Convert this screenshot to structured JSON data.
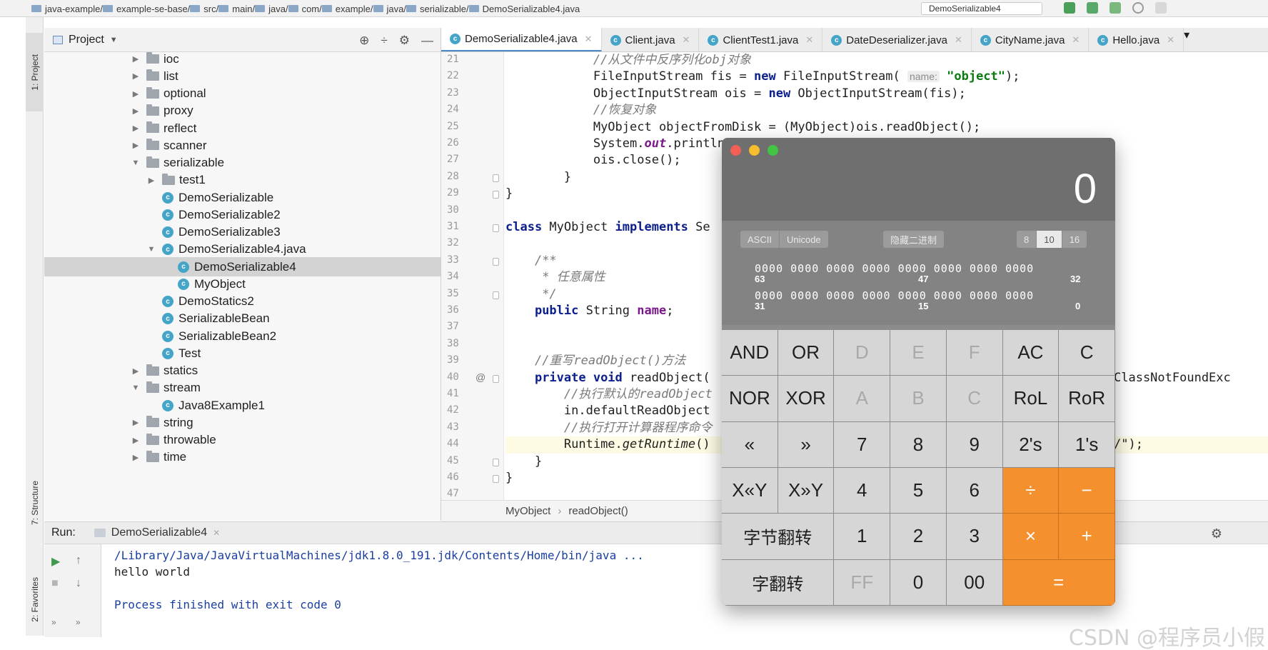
{
  "breadcrumbs": [
    "java-example",
    "example-se-base",
    "src",
    "main",
    "java",
    "com",
    "example",
    "java",
    "serializable",
    "DemoSerializable4.java"
  ],
  "run_config": "DemoSerializable4",
  "left_stripe": {
    "project": "1: Project",
    "structure": "7: Structure",
    "favorites": "2: Favorites"
  },
  "project_panel": {
    "title": "Project",
    "tree": [
      {
        "label": "ioc",
        "kind": "folder",
        "depth": 0,
        "expanded": false
      },
      {
        "label": "list",
        "kind": "folder",
        "depth": 0,
        "expanded": false
      },
      {
        "label": "optional",
        "kind": "folder",
        "depth": 0,
        "expanded": false
      },
      {
        "label": "proxy",
        "kind": "folder",
        "depth": 0,
        "expanded": false
      },
      {
        "label": "reflect",
        "kind": "folder",
        "depth": 0,
        "expanded": false
      },
      {
        "label": "scanner",
        "kind": "folder",
        "depth": 0,
        "expanded": false
      },
      {
        "label": "serializable",
        "kind": "folder",
        "depth": 0,
        "expanded": true
      },
      {
        "label": "test1",
        "kind": "folder",
        "depth": 1,
        "expanded": false
      },
      {
        "label": "DemoSerializable",
        "kind": "class",
        "depth": 1
      },
      {
        "label": "DemoSerializable2",
        "kind": "class",
        "depth": 1
      },
      {
        "label": "DemoSerializable3",
        "kind": "class",
        "depth": 1
      },
      {
        "label": "DemoSerializable4.java",
        "kind": "file",
        "depth": 1,
        "expanded": true
      },
      {
        "label": "DemoSerializable4",
        "kind": "class",
        "depth": 2,
        "selected": true
      },
      {
        "label": "MyObject",
        "kind": "class",
        "depth": 2
      },
      {
        "label": "DemoStatics2",
        "kind": "class",
        "depth": 1
      },
      {
        "label": "SerializableBean",
        "kind": "class",
        "depth": 1
      },
      {
        "label": "SerializableBean2",
        "kind": "class",
        "depth": 1
      },
      {
        "label": "Test",
        "kind": "class",
        "depth": 1
      },
      {
        "label": "statics",
        "kind": "folder",
        "depth": 0,
        "expanded": false
      },
      {
        "label": "stream",
        "kind": "folder",
        "depth": 0,
        "expanded": true
      },
      {
        "label": "Java8Example1",
        "kind": "class",
        "depth": 1
      },
      {
        "label": "string",
        "kind": "folder",
        "depth": 0,
        "expanded": false
      },
      {
        "label": "throwable",
        "kind": "folder",
        "depth": 0,
        "expanded": false
      },
      {
        "label": "time",
        "kind": "folder",
        "depth": 0,
        "expanded": false
      }
    ]
  },
  "tabs": [
    {
      "label": "DemoSerializable4.java",
      "active": true
    },
    {
      "label": "Client.java",
      "active": false
    },
    {
      "label": "ClientTest1.java",
      "active": false
    },
    {
      "label": "DateDeserializer.java",
      "active": false
    },
    {
      "label": "CityName.java",
      "active": false
    },
    {
      "label": "Hello.java",
      "active": false
    }
  ],
  "editor": {
    "line_numbers": [
      "21",
      "22",
      "23",
      "24",
      "25",
      "26",
      "27",
      "28",
      "29",
      "30",
      "31",
      "32",
      "33",
      "34",
      "35",
      "36",
      "37",
      "38",
      "39",
      "40",
      "41",
      "42",
      "43",
      "44",
      "45",
      "46",
      "47"
    ],
    "lines": [
      {
        "indent": "            ",
        "parts": [
          [
            "cm",
            "//从文件中反序列化obj对象"
          ]
        ]
      },
      {
        "indent": "            ",
        "parts": [
          [
            "t",
            "FileInputStream fis = "
          ],
          [
            "kw",
            "new"
          ],
          [
            "t",
            " FileInputStream( "
          ],
          [
            "hint",
            "name:"
          ],
          [
            "t",
            " "
          ],
          [
            "str",
            "\"object\""
          ],
          [
            "t",
            ");"
          ]
        ]
      },
      {
        "indent": "            ",
        "parts": [
          [
            "t",
            "ObjectInputStream ois = "
          ],
          [
            "kw",
            "new"
          ],
          [
            "t",
            " ObjectInputStream(fis);"
          ]
        ]
      },
      {
        "indent": "            ",
        "parts": [
          [
            "cm",
            "//恢复对象"
          ]
        ]
      },
      {
        "indent": "            ",
        "parts": [
          [
            "t",
            "MyObject objectFromDisk = (MyObject)ois.readObject();"
          ]
        ]
      },
      {
        "indent": "            ",
        "parts": [
          [
            "t",
            "System."
          ],
          [
            "fld",
            "out"
          ],
          [
            "t",
            ".println(o"
          ]
        ]
      },
      {
        "indent": "            ",
        "parts": [
          [
            "t",
            "ois.close();"
          ]
        ]
      },
      {
        "indent": "        ",
        "parts": [
          [
            "t",
            "}"
          ]
        ]
      },
      {
        "indent": "",
        "parts": [
          [
            "t",
            "}"
          ]
        ]
      },
      {
        "indent": "",
        "parts": []
      },
      {
        "indent": "",
        "parts": [
          [
            "kw",
            "class"
          ],
          [
            "t",
            " MyObject "
          ],
          [
            "kw",
            "implements"
          ],
          [
            "t",
            " Se"
          ]
        ]
      },
      {
        "indent": "",
        "parts": []
      },
      {
        "indent": "    ",
        "parts": [
          [
            "cm",
            "/**"
          ]
        ]
      },
      {
        "indent": "    ",
        "parts": [
          [
            "cm",
            " * 任意属性"
          ]
        ]
      },
      {
        "indent": "    ",
        "parts": [
          [
            "cm",
            " */"
          ]
        ]
      },
      {
        "indent": "    ",
        "parts": [
          [
            "kw",
            "public"
          ],
          [
            "t",
            " String "
          ],
          [
            "fld2",
            "name"
          ],
          [
            "t",
            ";"
          ]
        ]
      },
      {
        "indent": "",
        "parts": []
      },
      {
        "indent": "",
        "parts": []
      },
      {
        "indent": "    ",
        "parts": [
          [
            "cm",
            "//重写readObject()方法"
          ]
        ]
      },
      {
        "indent": "    ",
        "parts": [
          [
            "kw",
            "private void"
          ],
          [
            "t",
            " readObject("
          ]
        ]
      },
      {
        "indent": "        ",
        "parts": [
          [
            "cm",
            "//执行默认的readObject"
          ]
        ]
      },
      {
        "indent": "        ",
        "parts": [
          [
            "t",
            "in.defaultReadObject"
          ]
        ]
      },
      {
        "indent": "        ",
        "parts": [
          [
            "cm",
            "//执行打开计算器程序命令"
          ]
        ]
      },
      {
        "indent": "        ",
        "parts": [
          [
            "t",
            "Runtime."
          ],
          [
            "mth",
            "getRuntime"
          ],
          [
            "t",
            "()"
          ]
        ]
      },
      {
        "indent": "    ",
        "parts": [
          [
            "t",
            "}"
          ]
        ]
      },
      {
        "indent": "",
        "parts": [
          [
            "t",
            "}"
          ]
        ]
      },
      {
        "indent": "",
        "parts": []
      }
    ],
    "right_fragments": [
      {
        "line": 19,
        "text": "ClassNotFoundExc"
      },
      {
        "line": 23,
        "text": "/\");"
      }
    ],
    "breadcrumb": [
      "MyObject",
      "readObject()"
    ]
  },
  "run_panel": {
    "label": "Run:",
    "tab": "DemoSerializable4",
    "console": [
      {
        "text": "/Library/Java/JavaVirtualMachines/jdk1.8.0_191.jdk/Contents/Home/bin/java ...",
        "style": "blue"
      },
      {
        "text": "hello world",
        "style": "plain"
      },
      {
        "text": "",
        "style": "plain"
      },
      {
        "text": "Process finished with exit code 0",
        "style": "blue"
      }
    ]
  },
  "calculator": {
    "display": "0",
    "traffic_lights": [
      "#f25f57",
      "#f6bd2f",
      "#42c444"
    ],
    "modes": {
      "encoding": [
        "ASCII",
        "Unicode"
      ],
      "binary_toggle": "隐藏二进制",
      "base": [
        "8",
        "10",
        "16"
      ],
      "base_selected": "10"
    },
    "bits": {
      "row1": "0000 0000 0000 0000 0000 0000 0000 0000",
      "row2": "0000 0000 0000 0000 0000 0000 0000 0000",
      "labels_row1": [
        "63",
        "47",
        "32"
      ],
      "labels_row2": [
        "31",
        "15",
        "0"
      ]
    },
    "keys": [
      [
        "AND",
        "OR",
        "D",
        "E",
        "F",
        "AC",
        "C"
      ],
      [
        "NOR",
        "XOR",
        "A",
        "B",
        "C",
        "RoL",
        "RoR"
      ],
      [
        "«",
        "»",
        "7",
        "8",
        "9",
        "2's",
        "1's"
      ],
      [
        "X«Y",
        "X»Y",
        "4",
        "5",
        "6",
        "÷",
        "−"
      ],
      [
        "字节翻转",
        "1",
        "2",
        "3",
        "×",
        "+"
      ],
      [
        "字翻转",
        "FF",
        "0",
        "00",
        "="
      ]
    ],
    "accent_color": "#f5902e"
  },
  "watermark": "CSDN @程序员小假"
}
